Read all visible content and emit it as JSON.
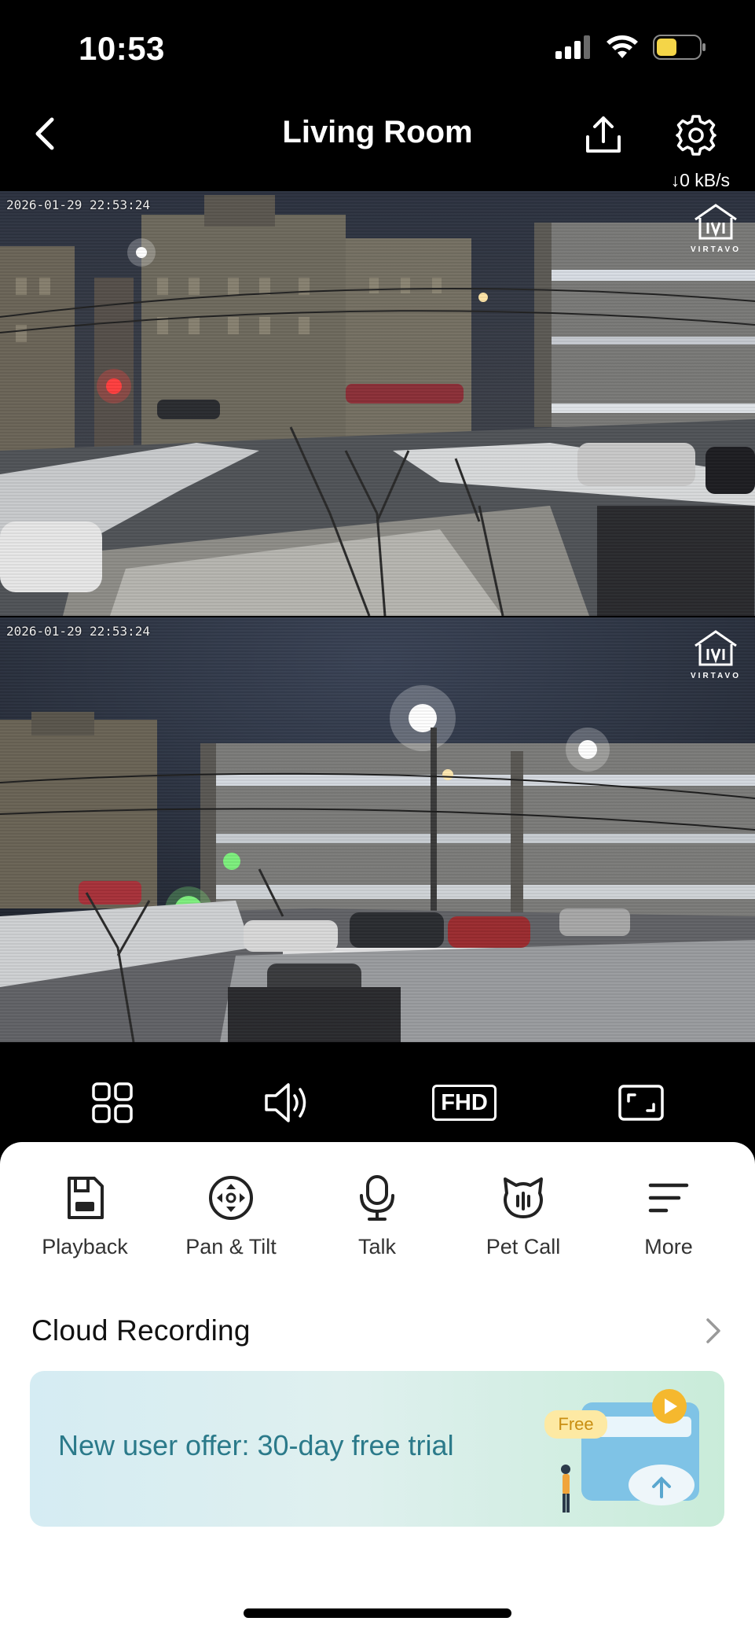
{
  "status_bar": {
    "time": "10:53",
    "battery_color": "#f4d548"
  },
  "header": {
    "title": "Living Room",
    "bitrate": "↓0 kB/s"
  },
  "feeds": [
    {
      "timestamp": "2026-01-29 22:53:24",
      "watermark": "VIRTAVO"
    },
    {
      "timestamp": "2026-01-29 22:53:24",
      "watermark": "VIRTAVO"
    }
  ],
  "controls": {
    "layout": "grid-icon",
    "sound": "speaker-icon",
    "quality_label": "FHD",
    "fullscreen": "fullscreen-icon"
  },
  "actions": [
    {
      "label": "Playback",
      "icon": "playback-icon"
    },
    {
      "label": "Pan & Tilt",
      "icon": "pan-tilt-icon"
    },
    {
      "label": "Talk",
      "icon": "microphone-icon"
    },
    {
      "label": "Pet Call",
      "icon": "pet-icon"
    },
    {
      "label": "More",
      "icon": "menu-icon"
    }
  ],
  "cloud": {
    "title": "Cloud Recording"
  },
  "offer": {
    "text": "New user offer: 30-day free trial",
    "badge": "Free",
    "accent": "#2b7a8a"
  }
}
